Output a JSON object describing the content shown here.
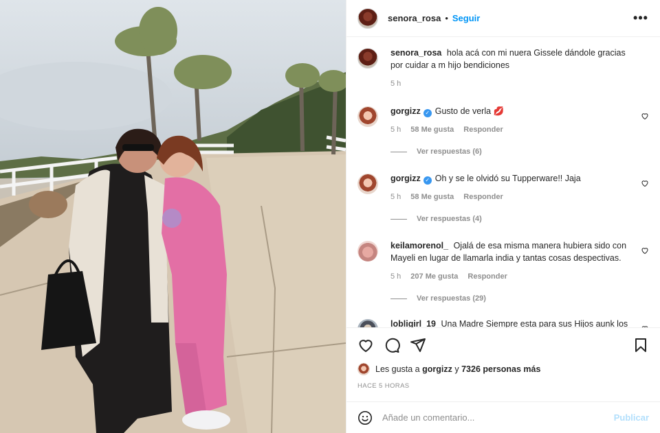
{
  "post": {
    "image_alt": "Two women hugging outdoors on a paved path with palm trees",
    "header": {
      "username": "senora_rosa",
      "separator": "•",
      "follow_label": "Seguir",
      "more_icon": "more-horizontal-icon"
    },
    "caption": {
      "username": "senora_rosa",
      "text": "hola acá con mi nuera Gissele dándole gracias por cuidar a m hijo bendiciones",
      "time": "5 h"
    },
    "comments": [
      {
        "username": "gorgizz",
        "verified": true,
        "text": "Gusto de verla 💋",
        "time": "5 h",
        "likes": "58 Me gusta",
        "reply_label": "Responder",
        "view_replies": "Ver respuestas (6)"
      },
      {
        "username": "gorgizz",
        "verified": true,
        "text": "Oh y se le olvidó su Tupperware!! Jaja",
        "time": "5 h",
        "likes": "58 Me gusta",
        "reply_label": "Responder",
        "view_replies": "Ver respuestas (4)"
      },
      {
        "username": "keilamorenol_",
        "verified": false,
        "text": "Ojalá de esa misma manera hubiera sido con Mayeli en lugar de llamarla india y tantas cosas despectivas.",
        "time": "5 h",
        "likes": "207 Me gusta",
        "reply_label": "Responder",
        "view_replies": "Ver respuestas (29)"
      },
      {
        "username": "lobligirl_19",
        "verified": false,
        "text": "Una Madre Siempre esta para sus Hijos aunk los hijos se porten mal el amor de madre es incondicional, que"
      }
    ],
    "actions": {
      "like_icon": "heart-icon",
      "comment_icon": "comment-icon",
      "share_icon": "send-icon",
      "save_icon": "bookmark-icon"
    },
    "likes_summary": {
      "prefix": "Les gusta a",
      "user": "gorgizz",
      "connector": "y",
      "others": "7326 personas más"
    },
    "posted_time": "HACE 5 HORAS",
    "add_comment": {
      "placeholder": "Añade un comentario...",
      "publish_label": "Publicar",
      "emoji_icon": "emoji-icon"
    }
  },
  "colors": {
    "accent": "#0095f6",
    "publish_disabled": "#b2dffc",
    "verified": "#3897f0",
    "muted_text": "#8e8e8e",
    "border": "#efefef"
  }
}
